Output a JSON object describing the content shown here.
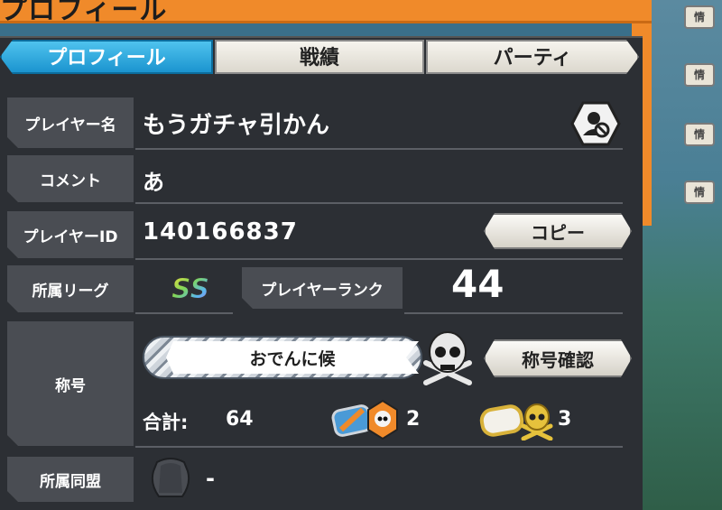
{
  "header": {
    "title": "プロフィール"
  },
  "tabs": [
    {
      "label": "プロフィール",
      "active": true
    },
    {
      "label": "戦績",
      "active": false
    },
    {
      "label": "パーティ",
      "active": false
    }
  ],
  "profile": {
    "player_name_label": "プレイヤー名",
    "player_name": "もうガチャ引かん",
    "comment_label": "コメント",
    "comment": "あ",
    "player_id_label": "プレイヤーID",
    "player_id": "140166837",
    "copy_button": "コピー",
    "league_label": "所属リーグ",
    "league_badge": "SS",
    "rank_label": "プレイヤーランク",
    "rank": "44",
    "title_label": "称号",
    "title_name": "おでんに候",
    "title_confirm_button": "称号確認",
    "total_label": "合計:",
    "total_value": "64",
    "orange_title_count": "2",
    "gold_title_count": "3",
    "alliance_label": "所属同盟",
    "alliance_value": "-"
  },
  "side_hints": [
    "情",
    "情",
    "情",
    "情"
  ],
  "colors": {
    "header_orange": "#f08a2a",
    "tab_active_blue": "#1b94cf",
    "panel_dark": "#2c2f34",
    "label_gray": "#4a4d53"
  },
  "icons": {
    "name_badge": "hexagon-user-icon",
    "title_skull": "skull-crossbones-icon",
    "orange_title": "orange-skull-badge-icon",
    "gold_title": "gold-skull-badge-icon",
    "alliance_emblem": "alliance-emblem-icon"
  }
}
